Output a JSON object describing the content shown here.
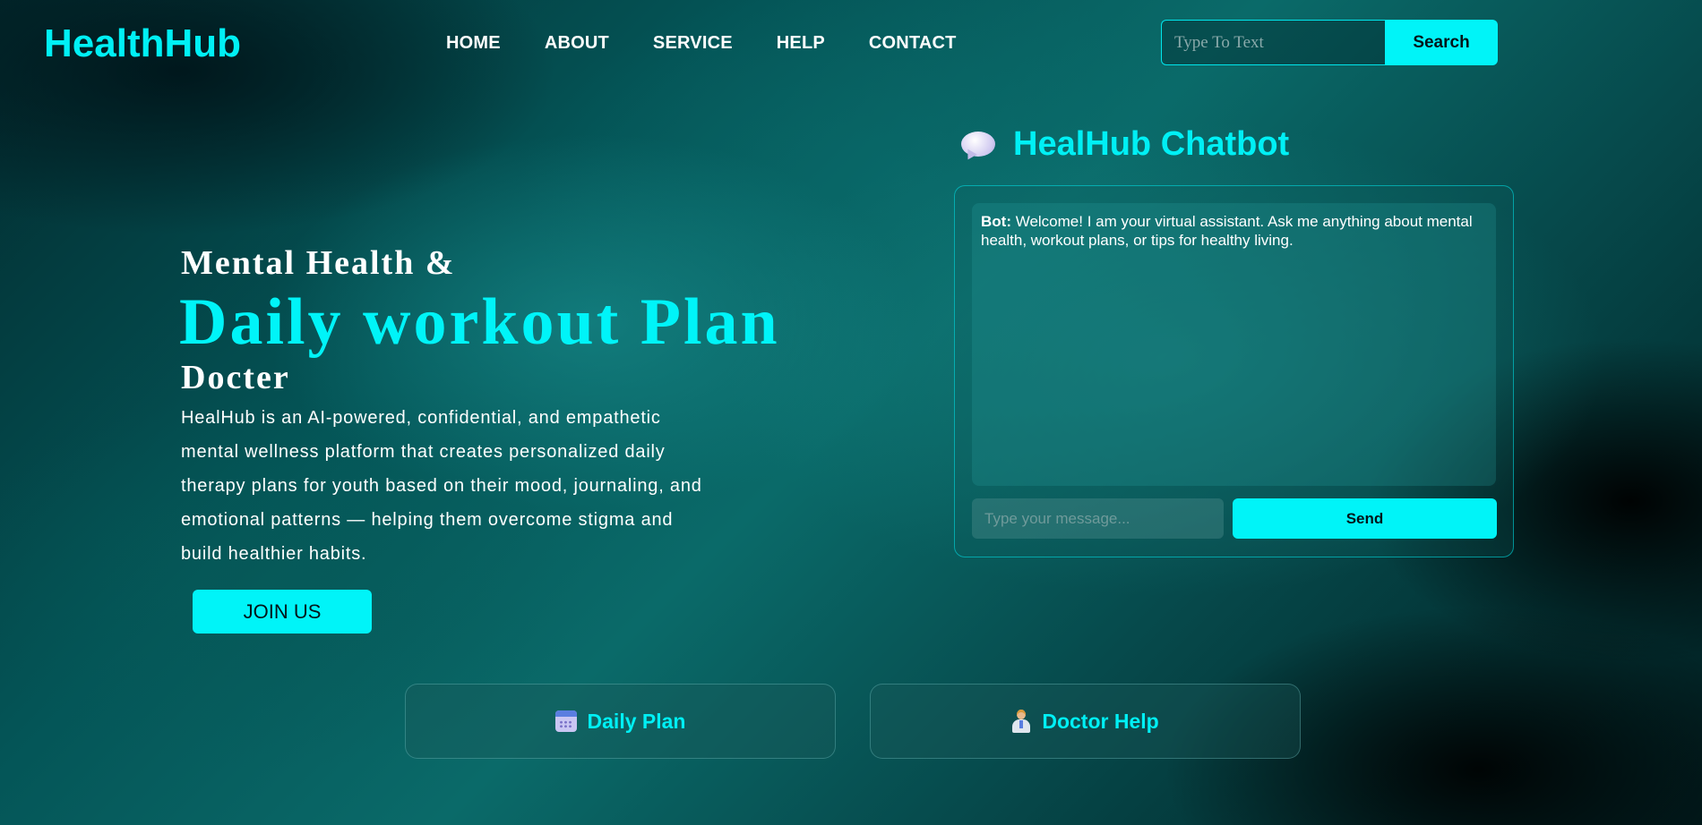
{
  "header": {
    "logo": "HealthHub",
    "nav": [
      "HOME",
      "ABOUT",
      "SERVICE",
      "HELP",
      "CONTACT"
    ],
    "search": {
      "placeholder": "Type To Text",
      "button": "Search"
    }
  },
  "hero": {
    "line1": "Mental Health &",
    "line2": "Daily workout Plan",
    "line3": "Docter",
    "description": "HealHub is an AI-powered, confidential, and empathetic mental wellness platform that creates personalized daily therapy plans for youth based on their mood, journaling, and emotional patterns — helping them overcome stigma and build healthier habits.",
    "join_button": "JOIN US"
  },
  "chatbot": {
    "icon": "speech-bubble-icon",
    "title": "HealHub Chatbot",
    "messages": [
      {
        "sender": "Bot:",
        "text": " Welcome! I am your virtual assistant. Ask me anything about mental health, workout plans, or tips for healthy living."
      }
    ],
    "input_placeholder": "Type your message...",
    "send_button": "Send"
  },
  "cards": [
    {
      "icon": "calendar-icon",
      "label": "Daily Plan"
    },
    {
      "icon": "doctor-icon",
      "label": "Doctor Help"
    }
  ],
  "colors": {
    "accent": "#00f4f8",
    "text": "#ffffff",
    "background": "#045557"
  }
}
